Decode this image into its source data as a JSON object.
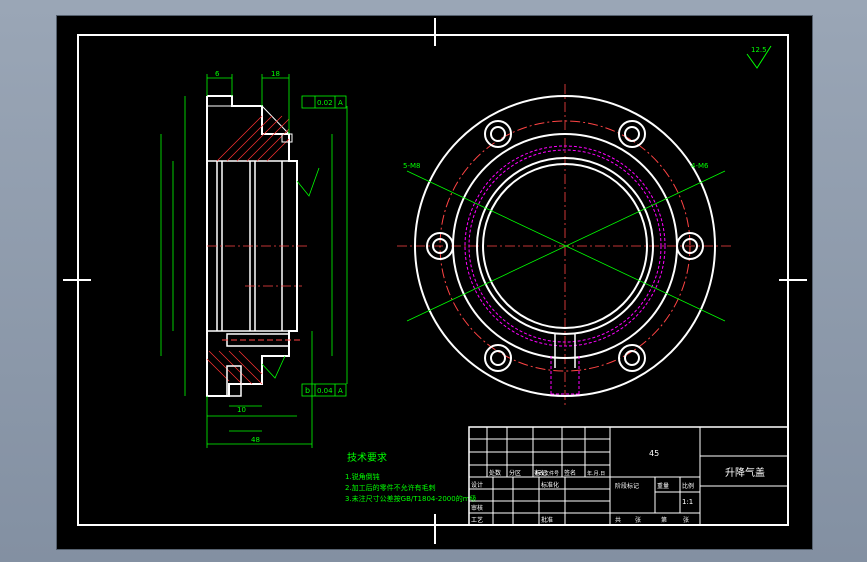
{
  "drawing": {
    "part_name": "升降气盖",
    "material": "45",
    "scale": "1:1",
    "roughness_note": "12.5",
    "tech_requirements": {
      "title": "技术要求",
      "items": [
        "1.锐角倒钝",
        "2.加工后的零件不允许有毛刺",
        "3.未注尺寸公差按GB/T1804-2000的m级"
      ]
    },
    "title_block": {
      "mark": "标记",
      "count": "处数",
      "zone": "分区",
      "change_doc": "更改文件号",
      "signature": "签名",
      "date": "年.月.日",
      "designer": "设计",
      "standardize": "标准化",
      "stage_mark": "阶段标记",
      "weight": "重量",
      "scale_label": "比例",
      "review": "审核",
      "process": "工艺",
      "approve": "批准",
      "sheet_total": "共",
      "sheet": "张",
      "sheet_no": "第",
      "sheet_unit": "张"
    },
    "section_dims": {
      "top_a": "6",
      "top_b": "18",
      "tol_top_value": "0.02",
      "tol_top_ref": "A",
      "tol_bottom_value": "0.04",
      "tol_bottom_ref": "A",
      "datum_b": "b",
      "bore_a": "48",
      "bore_b": "10"
    },
    "flange_dims": {
      "left_label": "5-M8",
      "right_label": "4-M6"
    }
  }
}
